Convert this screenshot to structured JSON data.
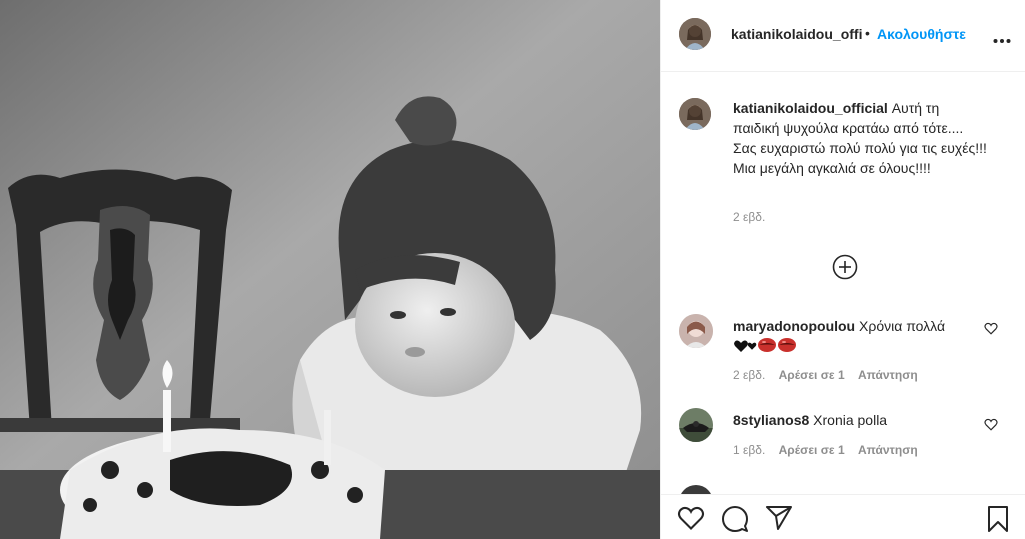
{
  "post": {
    "photo_icon": "black-and-white-child-birthday-cake-photo",
    "author": {
      "username": "katianikolaidou_official",
      "username_truncated": "katianikolaidou_offi",
      "follow_dot": "•",
      "follow_label": "Ακολουθήστε"
    },
    "caption": {
      "username": "katianikolaidou_official",
      "text": "Αυτή τη παιδική ψυχούλα κρατάω από τότε.... Σας ευχαριστώ πολύ πολύ για τις ευχές!!! Μια μεγάλη αγκαλιά σε όλους!!!!",
      "time": "2 εβδ."
    },
    "comments": [
      {
        "username": "maryadonopoulou",
        "text": "Χρόνια πολλά",
        "emoji": [
          "black-heart",
          "black-heart",
          "kiss-mark",
          "kiss-mark"
        ],
        "time": "2 εβδ.",
        "likes": "Αρέσει σε 1",
        "reply": "Απάντηση"
      },
      {
        "username": "8stylianos8",
        "text": "Xronia polla",
        "time": "1 εβδ.",
        "likes": "Αρέσει σε 1",
        "reply": "Απάντηση"
      }
    ]
  },
  "icons": {
    "more": "more-horizontal-icon",
    "load_more": "plus-circle-icon",
    "like_comment": "heart-outline-icon",
    "like": "heart-outline-icon",
    "comment": "comment-bubble-icon",
    "share": "paper-plane-icon",
    "save": "bookmark-icon"
  },
  "colors": {
    "link": "#0095f6",
    "text": "#262626",
    "secondary": "#8e8e8e",
    "border": "#efefef"
  }
}
